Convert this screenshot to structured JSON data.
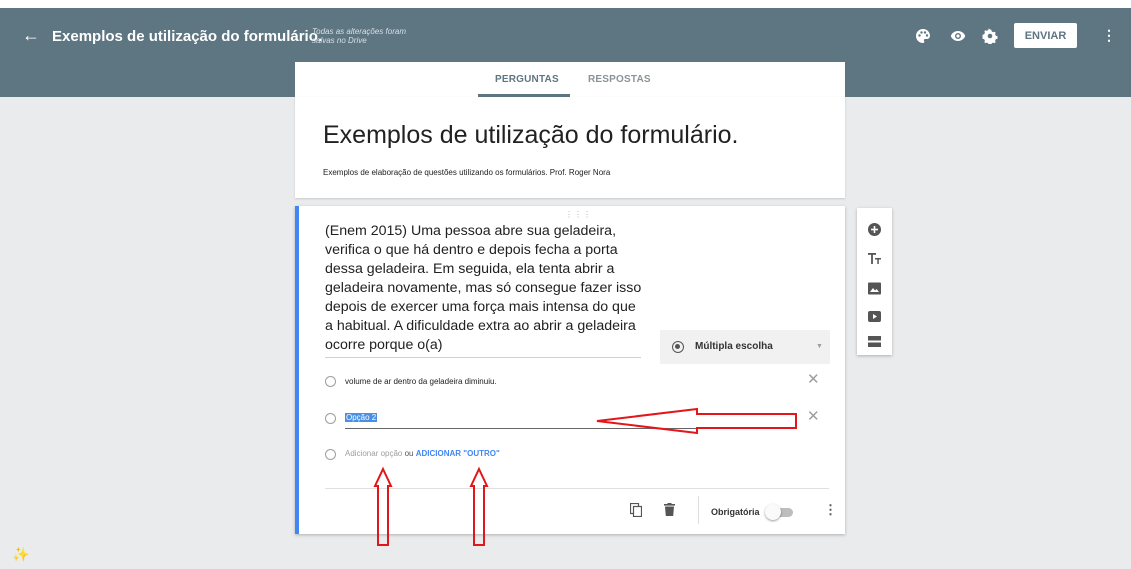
{
  "topbar": {
    "back_icon": "arrow-left-icon",
    "title": "Exemplos de utilização do formulário.",
    "saved_status": "Todas as alterações foram salvas no Drive",
    "icons": [
      "palette-icon",
      "eye-icon",
      "gear-icon"
    ],
    "send_label": "ENVIAR",
    "more_icon": "more-vert-icon",
    "background_color": "#5e7582"
  },
  "tabs": {
    "questions_label": "PERGUNTAS",
    "responses_label": "RESPOSTAS",
    "active": "PERGUNTAS"
  },
  "form": {
    "title": "Exemplos de utilização do formulário.",
    "description": "Exemplos de elaboração de questões utilizando os formulários.  Prof. Roger Nora"
  },
  "question": {
    "text": "(Enem 2015) Uma pessoa abre sua geladeira, verifica o que há dentro e depois fecha a porta dessa geladeira. Em seguida, ela tenta abrir a geladeira novamente, mas só consegue fazer isso depois de exercer uma força mais intensa do que a habitual. A dificuldade extra ao abrir a geladeira ocorre porque o(a)",
    "type_label": "Múltipla escolha",
    "options": [
      {
        "label": "volume de ar dentro da geladeira diminuiu."
      },
      {
        "label": "Opção 2"
      }
    ],
    "add_option_label": "Adicionar opção",
    "or_label": "ou",
    "add_other_label": "ADICIONAR \"OUTRO\"",
    "required_label": "Obrigatória",
    "required_on": false,
    "accent_color": "#4285f4"
  },
  "side_toolbar": {
    "icons": [
      "add-question-icon",
      "title-text-icon",
      "image-icon",
      "video-icon",
      "section-icon"
    ]
  },
  "annotation_color": "#e3161b"
}
